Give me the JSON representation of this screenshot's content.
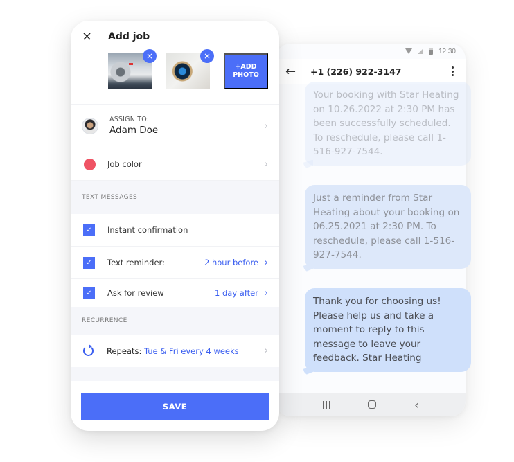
{
  "add_job": {
    "title": "Add job",
    "close_icon": "×",
    "photos": [
      {
        "name": "air-conditioner-photo",
        "remove_icon": "×"
      },
      {
        "name": "thermostat-photo",
        "remove_icon": "×"
      }
    ],
    "add_photo_label": "+ADD\nPHOTO",
    "assign": {
      "label": "ASSIGN TO:",
      "name": "Adam Doe"
    },
    "job_color": {
      "label": "Job color",
      "color": "#ef5364"
    },
    "text_messages": {
      "section_title": "TEXT MESSAGES",
      "items": [
        {
          "label": "Instant confirmation",
          "checked": true,
          "value": ""
        },
        {
          "label": "Text reminder:",
          "checked": true,
          "value": "2 hour before"
        },
        {
          "label": "Ask for review",
          "checked": true,
          "value": "1 day after"
        }
      ]
    },
    "recurrence": {
      "section_title": "RECURRENCE",
      "label": "Repeats:",
      "value": "Tue & Fri every 4 weeks"
    },
    "save_label": "SAVE",
    "chevron": "›",
    "chevron_blue": "›",
    "checkmark": "✓"
  },
  "sms": {
    "status_time": "12:30",
    "back_icon": "←",
    "contact": "+1 (226) 922-3147",
    "messages": [
      "Your booking with Star Heating on 10.26.2022 at 2:30 PM has been successfully scheduled. To reschedule, please call 1-516-927-7544.",
      "Just a reminder from Star Heating about your booking on 06.25.2021 at 2:30 PM. To reschedule, please call 1-516-927-7544.",
      "Thank you for choosing us! Please help us and take a moment to reply to this message to leave your feedback. Star Heating"
    ],
    "nav_back": "‹"
  },
  "colors": {
    "accent": "#4b6ef8",
    "link": "#3a5ef0",
    "bubble": "#cfe0fb",
    "section_bg": "#f5f6fa"
  }
}
